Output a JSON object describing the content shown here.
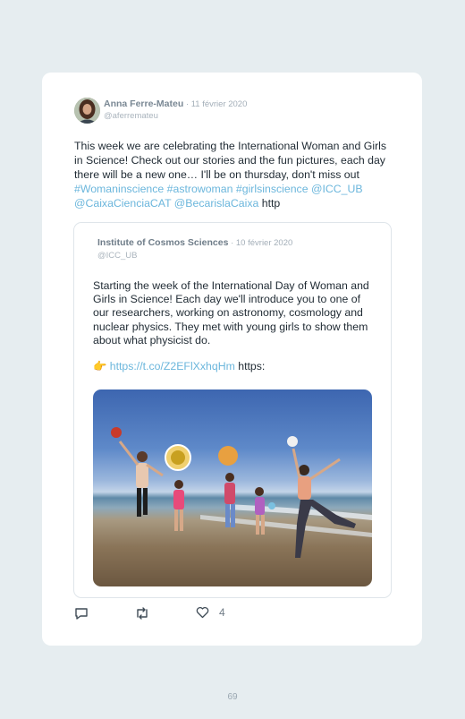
{
  "tweet": {
    "author_name": "Anna Ferre-Mateu",
    "date": " · 11 février 2020",
    "handle": "@aferremateu",
    "text_before": "This week we are celebrating the International Woman and Girls in Science! Check out our stories and the fun pictures, each day there will be a new one… I'll be on thursday, don't miss out ",
    "hashtags": "#Womaninscience #astrowoman #girlsinscience @ICC_UB @CaixaCienciaCAT @BecarislaCaixa",
    "text_after": " http"
  },
  "quote": {
    "author_name": "Institute of Cosmos Sciences",
    "date": " · 10 février 2020",
    "handle": "@ICC_UB",
    "text": "Starting the week of the International Day of Woman and Girls in Science! Each day we'll introduce you to one of our researchers, working on astronomy, cosmology and nuclear physics. They met with young girls to show them about what physicist do.",
    "pointer_emoji": "👉",
    "link": "https://t.co/Z2EFlXxhqHm",
    "link_after": " https:"
  },
  "actions": {
    "like_count": "4",
    "icons": [
      "reply-icon",
      "retweet-icon",
      "heart-icon"
    ]
  },
  "page_number": "69",
  "colors": {
    "background": "#e6edf0",
    "card": "#ffffff",
    "link": "#6bb6dc",
    "text": "#1f2a33"
  }
}
